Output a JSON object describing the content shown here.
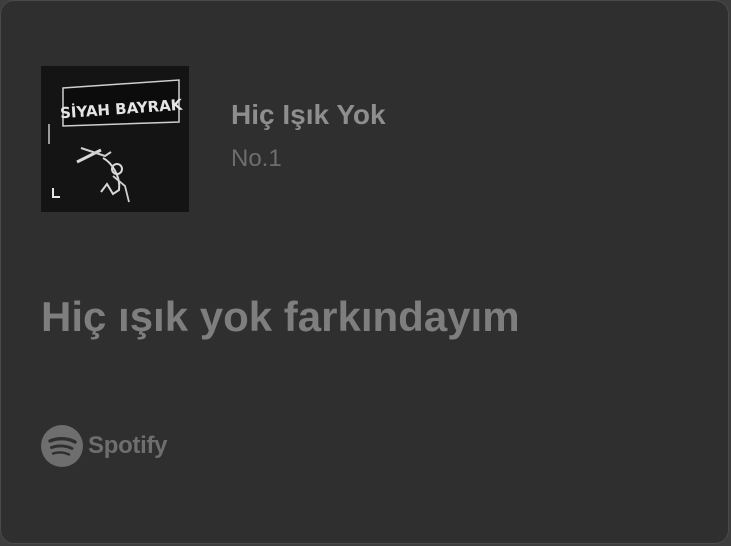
{
  "card": {
    "album_cover": {
      "cover_text": "SİYAH BAYRAK"
    },
    "track": {
      "title": "Hiç Işık Yok",
      "subtitle": "No.1"
    },
    "lyric": "Hiç ışık yok farkındayım",
    "brand": {
      "icon": "spotify-icon",
      "name": "Spotify"
    }
  },
  "colors": {
    "card_background": "#2f2f2f",
    "title_text": "#8e8e8e",
    "subtitle_text": "#6d6d6d",
    "lyric_text": "#7e7e7e",
    "brand": "#6e6e6e"
  }
}
